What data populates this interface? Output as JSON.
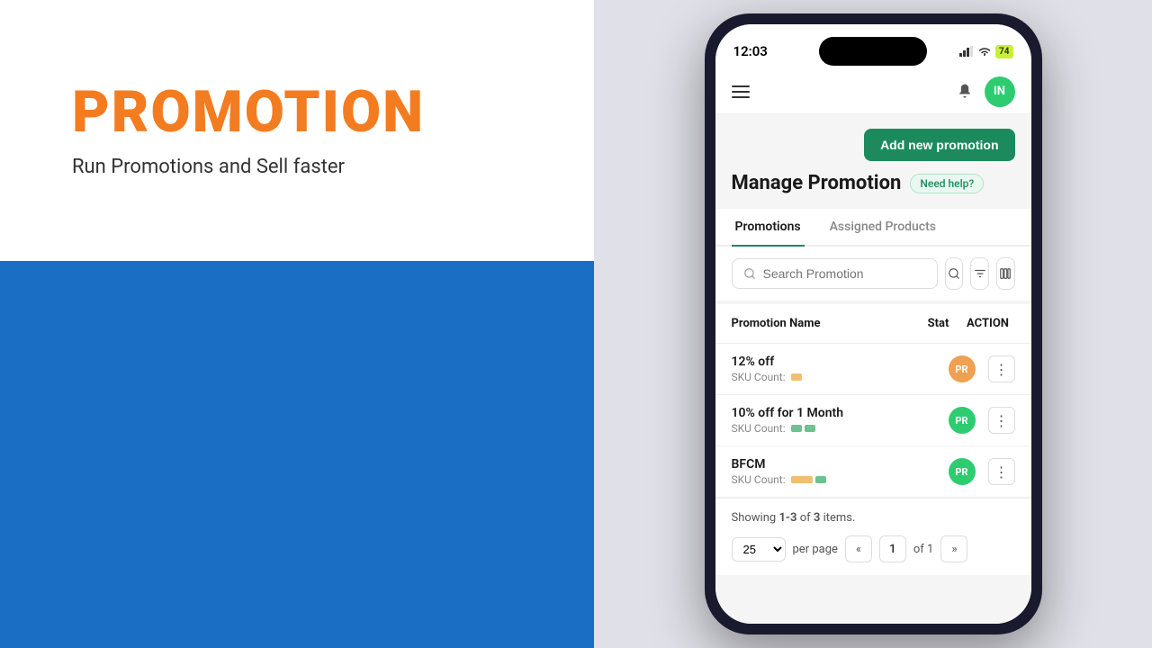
{
  "left": {
    "title": "PROMOTION",
    "subtitle": "Run Promotions and Sell faster",
    "title_color": "#f47c20",
    "bg_blue": "#1a6fc4"
  },
  "phone": {
    "status_bar": {
      "time": "12:03",
      "battery": "74"
    },
    "nav": {
      "avatar_initials": "IN"
    },
    "header": {
      "add_button_label": "Add new promotion",
      "page_title": "Manage Promotion",
      "help_badge": "Need help?"
    },
    "tabs": [
      {
        "label": "Promotions",
        "active": true
      },
      {
        "label": "Assigned Products",
        "active": false
      }
    ],
    "search": {
      "placeholder": "Search Promotion"
    },
    "table": {
      "columns": {
        "name": "Promotion Name",
        "status": "Stat",
        "action": "ACTION"
      },
      "rows": [
        {
          "name": "12% off",
          "sku_label": "SKU Count:",
          "status_badge": "PR",
          "status_color": "orange"
        },
        {
          "name": "10% off for 1 Month",
          "sku_label": "SKU Count:",
          "status_badge": "PR",
          "status_color": "green"
        },
        {
          "name": "BFCM",
          "sku_label": "SKU Count:",
          "status_badge": "PR",
          "status_color": "green"
        }
      ]
    },
    "pagination": {
      "showing_text": "Showing ",
      "range": "1-3",
      "of_text": " of ",
      "total": "3",
      "items_text": " items.",
      "per_page": "25",
      "per_page_label": "per page",
      "first_btn": "«",
      "current_page": "1",
      "of_pages": "of 1",
      "next_btn": "»"
    }
  }
}
